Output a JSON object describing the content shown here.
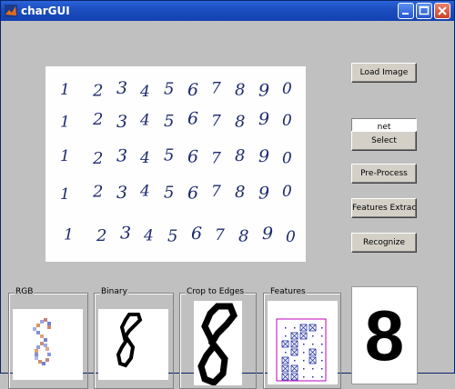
{
  "window": {
    "title": "charGUI"
  },
  "buttons": {
    "load_image": "Load Image",
    "select": "Select",
    "pre_process": "Pre-Process",
    "features_extraction": "Features Extraction",
    "recognize": "Recognize"
  },
  "net_field": {
    "value": "net"
  },
  "panels": {
    "rgb": "RGB",
    "binary": "Binary",
    "crop": "Crop to Edges",
    "features": "Features"
  },
  "result": {
    "digit": "8"
  },
  "sample_rows": [
    [
      "1",
      "2",
      "3",
      "4",
      "5",
      "6",
      "7",
      "8",
      "9",
      "0"
    ],
    [
      "1",
      "2",
      "3",
      "4",
      "5",
      "6",
      "7",
      "8",
      "9",
      "0"
    ],
    [
      "1",
      "2",
      "3",
      "4",
      "5",
      "6",
      "7",
      "8",
      "9",
      "0"
    ],
    [
      "1",
      "2",
      "3",
      "4",
      "5",
      "6",
      "7",
      "8",
      "9",
      "0"
    ],
    [
      "1",
      "2",
      "3",
      "4",
      "5",
      "6",
      "7",
      "8",
      "9",
      "0"
    ]
  ],
  "colors": {
    "title_bar": "#1c4fc1",
    "ink": "#1e2a6e",
    "features_border": "#c000c0",
    "features_marks": "#2030a0"
  }
}
